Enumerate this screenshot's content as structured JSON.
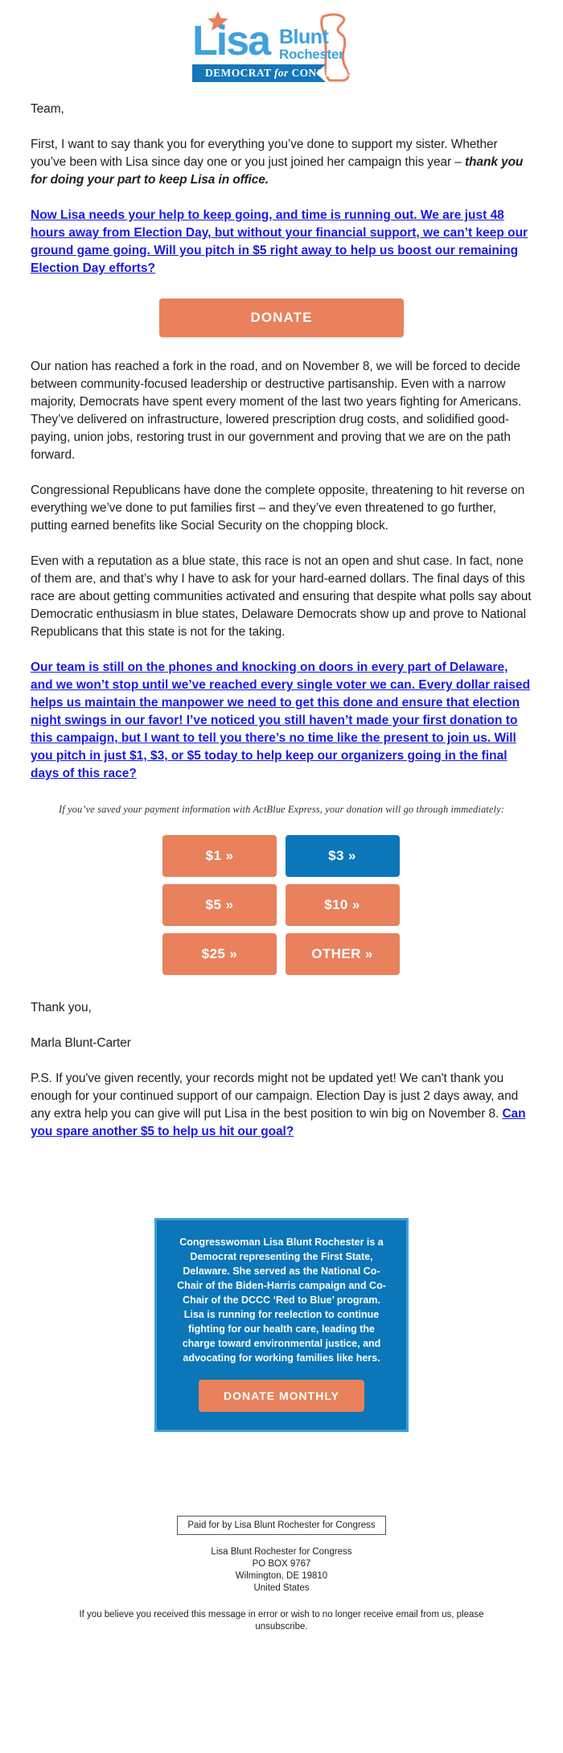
{
  "logo": {
    "first_name": "Lisa",
    "last_name_line1": "Blunt",
    "last_name_line2": "Rochester",
    "ribbon_text": "DEMOCRAT for CONGRESS",
    "star_icon": "star-icon",
    "state_outline_icon": "delaware-state-outline-icon",
    "colors": {
      "light_blue": "#3fa0dc",
      "dark_blue": "#0b76b8",
      "orange": "#e8815c"
    }
  },
  "body": {
    "salutation": "Team,",
    "para1_prefix": "First, I want to say thank you for everything you’ve done to support my sister. Whether you’ve been with Lisa since day one or you just joined her campaign this year – ",
    "para1_italic": "thank you for doing your part to keep Lisa in office.",
    "link1": "Now Lisa needs your help to keep going, and time is running out. We are just 48 hours away from Election Day, but without your financial support, we can’t keep our ground game going. Will you pitch in $5 right away to help us boost our remaining Election Day efforts?",
    "donate_label": "DONATE",
    "para2": "Our nation has reached a fork in the road, and on November 8, we will be forced to decide between community-focused leadership or destructive partisanship. Even with a narrow majority, Democrats have spent every moment of the last two years fighting for Americans. They’ve delivered on infrastructure, lowered prescription drug costs, and solidified good-paying, union jobs, restoring trust in our government and proving that we are on the path forward.",
    "para3": "Congressional Republicans have done the complete opposite, threatening to hit reverse on everything we’ve done to put families first – and they’ve even threatened to go further, putting earned benefits like Social Security on the chopping block.",
    "para4": "Even with a reputation as a blue state, this race is not an open and shut case. In fact, none of them are, and that’s why I have to ask for your hard-earned dollars. The final days of this race are about getting communities activated and ensuring that despite what polls say about Democratic enthusiasm in blue states, Delaware Democrats show up and prove to National Republicans that this state is not for the taking.",
    "link2": "Our team is still on the phones and knocking on doors in every part of Delaware, and we won’t stop until we’ve reached every single voter we can. Every dollar raised helps us maintain the manpower we need to get this done and ensure that election night swings in our favor! I’ve noticed you still haven’t made your first donation to this campaign, but I want to tell you there’s no time like the present to join us. Will you pitch in just $1, $3, or $5 today to help keep our organizers going in the final days of this race?",
    "actblue_note": "If you’ve saved your payment information with ActBlue Express, your donation will go through immediately:",
    "closing": "Thank you,",
    "signature": "Marla Blunt-Carter",
    "ps_prefix": "P.S. If you've given recently, your records might not be updated yet! We can't thank you enough for your continued support of our campaign. Election Day is just 2 days away, and any extra help you can give will put Lisa in the best position to win big on November 8. ",
    "ps_link": "Can you spare another $5 to help us hit our goal?"
  },
  "amounts": [
    {
      "label": "$1 »",
      "style": "orange"
    },
    {
      "label": "$3 »",
      "style": "blue"
    },
    {
      "label": "$5 »",
      "style": "orange"
    },
    {
      "label": "$10 »",
      "style": "orange"
    },
    {
      "label": "$25 »",
      "style": "orange"
    },
    {
      "label": "OTHER »",
      "style": "orange"
    }
  ],
  "bio": {
    "text": "Congresswoman Lisa Blunt Rochester is a Democrat representing the First State, Delaware. She served as the National Co-Chair of the Biden-Harris campaign and Co-Chair of the DCCC ‘Red to Blue’ program. Lisa is running for reelection to continue fighting for our health care, leading the charge toward environmental justice, and advocating for working families like hers.",
    "button_label": "DONATE MONTHLY"
  },
  "footer": {
    "paid_for": "Paid for by Lisa Blunt Rochester for Congress",
    "address_line1": "Lisa Blunt Rochester for Congress",
    "address_line2": "PO BOX 9767",
    "address_line3": "Wilmington, DE 19810",
    "address_line4": "United States",
    "disclaimer_prefix": "If you believe you received this message in error or wish to no longer receive email from us, please ",
    "unsubscribe_label": "unsubscribe",
    "disclaimer_suffix": "."
  }
}
